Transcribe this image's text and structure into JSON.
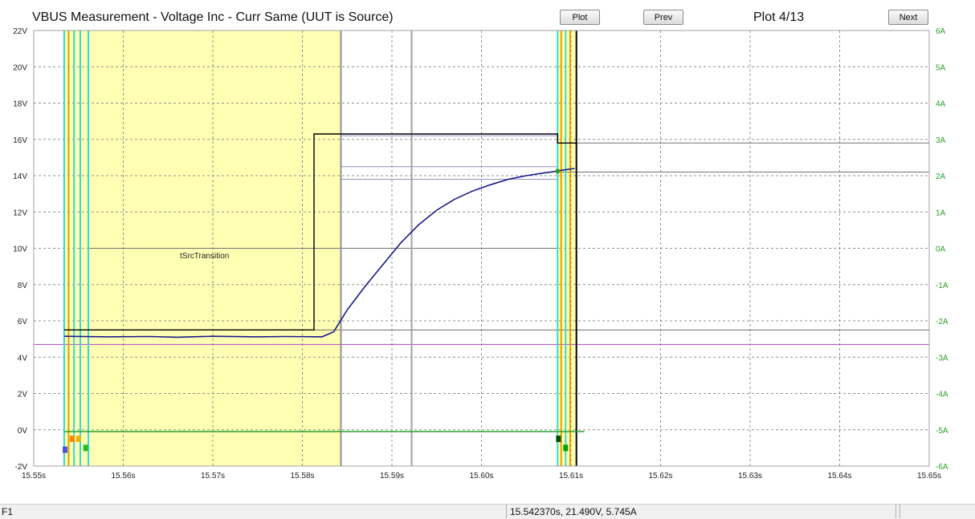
{
  "header": {
    "title": "VBUS Measurement - Voltage Inc - Curr Same (UUT is Source)",
    "plot_label": "Plot",
    "prev_label": "Prev",
    "plot_counter": "Plot 4/13",
    "next_label": "Next"
  },
  "status": {
    "left_label": "F1",
    "readout": "15.542370s, 21.490V, 5.745A"
  },
  "colors": {
    "shade": "#ffffb4",
    "voltage_trace": "#1a1a8c",
    "limit": "#000000",
    "cyan": "#38d8d8",
    "green": "#2aa02a",
    "current_axis": "#2aa02a",
    "purple": "#b040d0",
    "grid": "#909090"
  },
  "chart_data": {
    "type": "line",
    "annotation": "tSrcTransition",
    "x_ticks": [
      "15.55s",
      "15.56s",
      "15.57s",
      "15.58s",
      "15.59s",
      "15.60s",
      "15.61s",
      "15.62s",
      "15.63s",
      "15.64s",
      "15.65s"
    ],
    "y_left_ticks": [
      "22V",
      "20V",
      "18V",
      "16V",
      "14V",
      "12V",
      "10V",
      "8V",
      "6V",
      "4V",
      "2V",
      "0V",
      "-2V"
    ],
    "y_right_ticks": [
      "6A",
      "5A",
      "4A",
      "3A",
      "2A",
      "1A",
      "0A",
      "-1A",
      "-2A",
      "-3A",
      "-4A",
      "-5A",
      "-6A"
    ],
    "xlim": [
      15.55,
      15.65
    ],
    "ylim_left": [
      -2,
      22
    ],
    "ylim_right": [
      -6,
      6
    ],
    "grid": true,
    "shaded_regions": [
      [
        15.5534,
        15.5843
      ],
      [
        15.6085,
        15.6106
      ]
    ],
    "series": [
      {
        "role": "voltage",
        "color": "#1a1a8c",
        "x": [
          15.5534,
          15.558,
          15.563,
          15.566,
          15.57,
          15.575,
          15.578,
          15.5822,
          15.5835,
          15.585,
          15.587,
          15.589,
          15.591,
          15.593,
          15.595,
          15.597,
          15.599,
          15.601,
          15.603,
          15.605,
          15.607,
          15.6085,
          15.609,
          15.6104
        ],
        "y": [
          5.15,
          5.12,
          5.14,
          5.1,
          5.15,
          5.12,
          5.14,
          5.12,
          5.4,
          6.6,
          7.9,
          9.1,
          10.3,
          11.3,
          12.1,
          12.7,
          13.15,
          13.5,
          13.8,
          14.0,
          14.15,
          14.25,
          14.3,
          14.4
        ]
      },
      {
        "role": "upper-limit",
        "color": "#000000",
        "x": [
          15.5534,
          15.5813,
          15.5813,
          15.6085,
          15.6085,
          15.6106
        ],
        "y": [
          5.5,
          5.5,
          16.3,
          16.3,
          15.8,
          15.8
        ]
      },
      {
        "role": "current",
        "color": "#2aa02a",
        "x": [
          15.5534,
          15.5561,
          15.6103,
          15.6115
        ],
        "y": [
          -0.1,
          -0.1,
          -0.1,
          -0.1
        ]
      }
    ],
    "reference_lines": [
      {
        "y": 14.2,
        "x_start": 15.6085,
        "x_end": 15.65,
        "color": "#707070"
      },
      {
        "y": 15.8,
        "x_start": 15.6106,
        "x_end": 15.65,
        "color": "#707070"
      },
      {
        "y": 16.2,
        "x_start": 15.5843,
        "x_end": 15.6085,
        "color": "#9090c0"
      },
      {
        "y": 14.5,
        "x_start": 15.5843,
        "x_end": 15.6085,
        "color": "#9090c0"
      },
      {
        "y": 13.8,
        "x_start": 15.5843,
        "x_end": 15.6085,
        "color": "#9090c0"
      },
      {
        "y": 10.0,
        "x_start": 15.5561,
        "x_end": 15.6085,
        "color": "#707070"
      },
      {
        "y": 5.5,
        "x_start": 15.5813,
        "x_end": 15.65,
        "color": "#707070"
      },
      {
        "y": 4.7,
        "x_start": 15.55,
        "x_end": 15.65,
        "color": "#b040d0"
      }
    ],
    "vertical_markers": [
      {
        "x": 15.5534,
        "color": "#38d8d8"
      },
      {
        "x": 15.5539,
        "color": "#e0a000"
      },
      {
        "x": 15.5545,
        "color": "#38d8d8"
      },
      {
        "x": 15.5552,
        "color": "#38d8d8"
      },
      {
        "x": 15.5561,
        "color": "#38d8d8"
      },
      {
        "x": 15.5843,
        "color": "#909090"
      },
      {
        "x": 15.5922,
        "color": "#a0a0a0"
      },
      {
        "x": 15.6085,
        "color": "#38d8d8"
      },
      {
        "x": 15.6089,
        "color": "#e0a000"
      },
      {
        "x": 15.6094,
        "color": "#38d8d8"
      },
      {
        "x": 15.6099,
        "color": "#e0a000"
      },
      {
        "x": 15.6106,
        "color": "#000000"
      }
    ],
    "event_markers": [
      {
        "x": 15.5535,
        "y": -1.1,
        "color": "#5050e0"
      },
      {
        "x": 15.5543,
        "y": -0.5,
        "color": "#ff8800"
      },
      {
        "x": 15.555,
        "y": -0.5,
        "color": "#f0b000"
      },
      {
        "x": 15.5558,
        "y": -1.0,
        "color": "#20c020"
      },
      {
        "x": 15.6086,
        "y": -0.5,
        "color": "#005000"
      },
      {
        "x": 15.6094,
        "y": -1.0,
        "color": "#00a000"
      }
    ]
  }
}
